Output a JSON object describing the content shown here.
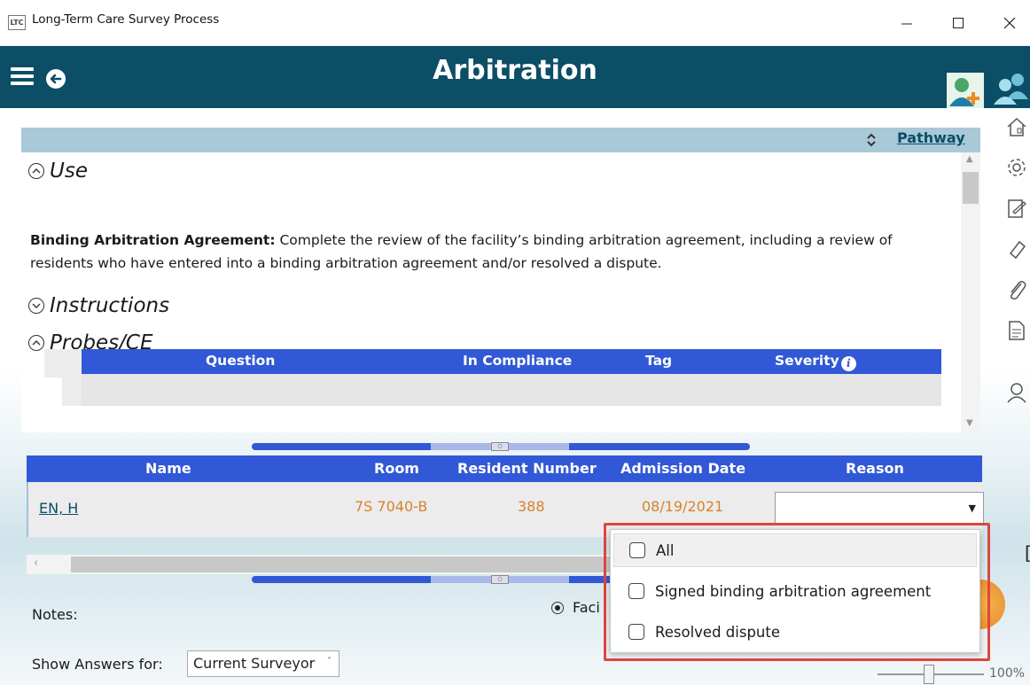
{
  "window": {
    "logo_text": "LTC",
    "title": "Long-Term Care Survey Process",
    "controls": {
      "minimize": "—",
      "maximize": "☐",
      "close": "✕"
    }
  },
  "header": {
    "title": "Arbitration",
    "icons": [
      "menu-icon",
      "back-arrow-icon",
      "add-person-icon",
      "people-icon"
    ]
  },
  "pathway": {
    "link_label": "Pathway"
  },
  "sections": {
    "use": {
      "heading": "Use",
      "bold_label": "Binding Arbitration Agreement:",
      "text": " Complete the review of the facility’s binding arbitration agreement, including a review of residents who have entered into a binding arbitration agreement and/or resolved a dispute."
    },
    "instructions": {
      "heading": "Instructions"
    },
    "probes": {
      "heading": "Probes/CE",
      "columns": {
        "question": "Question",
        "in_compliance": "In Compliance",
        "tag": "Tag",
        "severity": "Severity"
      },
      "info_glyph": "i"
    }
  },
  "residents": {
    "columns": {
      "name": "Name",
      "room": "Room",
      "resident_number": "Resident Number",
      "admission_date": "Admission Date",
      "reason": "Reason"
    },
    "rows": [
      {
        "name": "EN, H",
        "room": "7S 7040-B",
        "resident_number": "388",
        "admission_date": "08/19/2021",
        "reason": ""
      }
    ]
  },
  "notes": {
    "label": "Notes:",
    "radio_label": "Faci",
    "radio_selected": true
  },
  "show_answers": {
    "label": "Show Answers for:",
    "value": "Current Surveyor"
  },
  "zoom": {
    "label": "100%",
    "level_percent": 100
  },
  "reason_dropdown": {
    "options": [
      {
        "label": "All",
        "checked": false
      },
      {
        "label": "Signed binding arbitration agreement",
        "checked": false
      },
      {
        "label": "Resolved dispute",
        "checked": false
      }
    ]
  },
  "right_toolbar": [
    "home-icon",
    "gear-icon",
    "edit-note-icon",
    "eraser-icon",
    "paperclip-icon",
    "document-icon",
    "person-icon"
  ],
  "colors": {
    "header": "#0b4e66",
    "table_header": "#3158d6",
    "accent_orange": "#d9822b",
    "highlight": "#e0453f"
  }
}
